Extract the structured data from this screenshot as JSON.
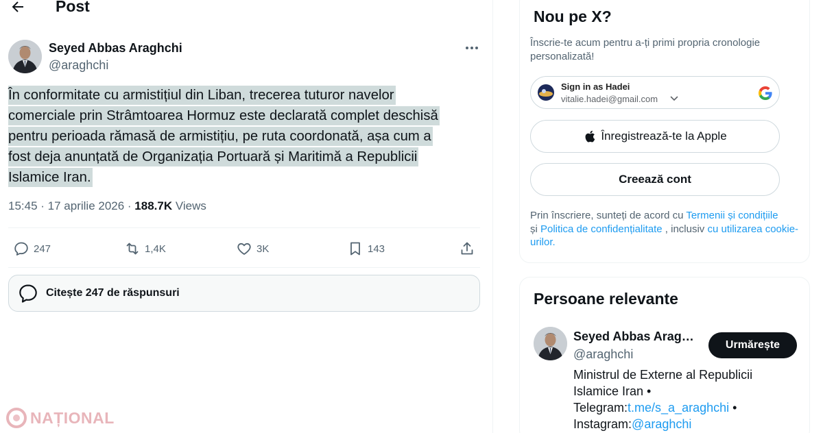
{
  "header": {
    "title": "Post"
  },
  "tweet": {
    "author_name": "Seyed Abbas Araghchi",
    "author_handle": "@araghchi",
    "text_lines": [
      "În conformitate cu armistițiul din Liban, trecerea tuturor navelor",
      "comerciale prin Strâmtoarea Hormuz este declarată complet deschisă",
      "pentru perioada rămasă de armistițiu, pe ruta coordonată, așa cum a",
      "fost deja anunțată de Organizația Portuară și Maritimă a Republicii",
      "Islamice Iran."
    ],
    "time": "15:45",
    "date": "17 aprilie 2026",
    "views_count": "188.7K",
    "views_label": "Views",
    "replies": "247",
    "reposts": "1,4K",
    "likes": "3K",
    "bookmarks": "143",
    "read_replies": "Citește 247 de răspunsuri"
  },
  "signup": {
    "title": "Nou pe X?",
    "description": "Înscrie-te acum pentru a-ți primi propria cronologie personalizată!",
    "google_signin": "Sign in as Hadei",
    "google_email": "vitalie.hadei@gmail.com",
    "apple_label": "Înregistrează-te la Apple",
    "create_account": "Creează cont",
    "terms_prefix": "Prin înscriere, sunteți de acord cu ",
    "terms_link": "Termenii și condițiile",
    "terms_and": "și ",
    "privacy_link": "Politica de confidențialitate",
    "terms_mid": " , inclusiv ",
    "cookie_link": "cu utilizarea cookie-urilor."
  },
  "relevant": {
    "title": "Persoane relevante",
    "name": "Seyed Abbas Arag…",
    "handle": "@araghchi",
    "follow_label": "Urmărește",
    "bio_line1": "Ministrul de Externe al Republicii",
    "bio_line2": "Islamice Iran •",
    "bio_telegram_label": "Telegram:",
    "bio_telegram_link": "t.me/s_a_araghchi",
    "bio_telegram_suffix": " •",
    "bio_instagram_label": "Instagram:",
    "bio_instagram_link": "@araghchi"
  },
  "watermark": {
    "text": "NAȚIONAL"
  },
  "colors": {
    "accent": "#1d9bf0",
    "text": "#0f1419",
    "muted": "#536471",
    "highlight": "#cfdbdb"
  },
  "icons": [
    "back-arrow-icon",
    "more-icon",
    "reply-icon",
    "repost-icon",
    "like-icon",
    "bookmark-icon",
    "share-icon",
    "chat-bubble-icon",
    "apple-icon",
    "google-icon",
    "chevron-down-icon"
  ]
}
